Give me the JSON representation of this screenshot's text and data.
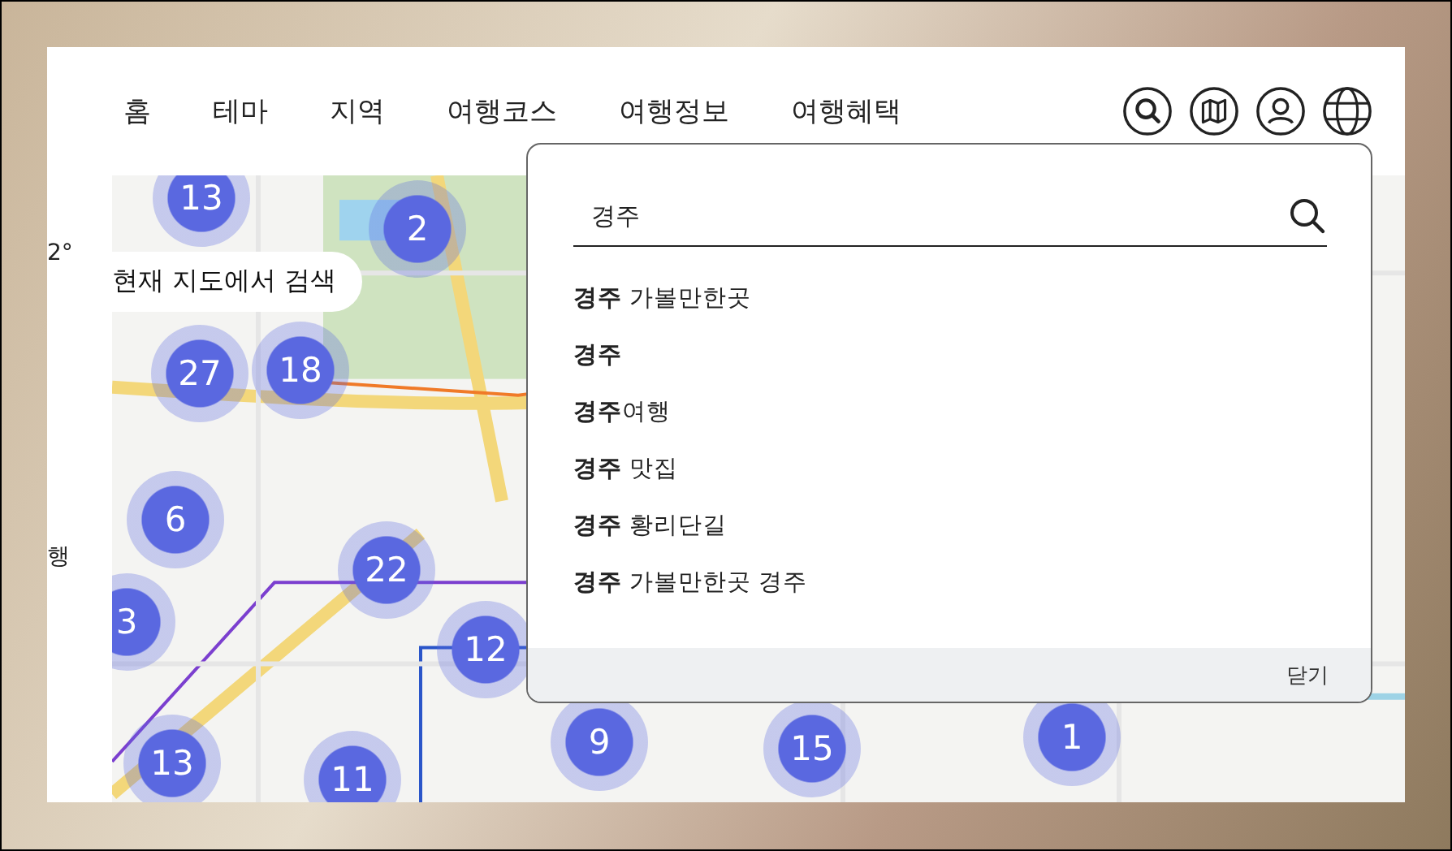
{
  "nav": {
    "items": [
      {
        "label": "홈"
      },
      {
        "label": "테마"
      },
      {
        "label": "지역"
      },
      {
        "label": "여행코스"
      },
      {
        "label": "여행정보"
      },
      {
        "label": "여행혜택"
      }
    ]
  },
  "left_panel": {
    "texts": [
      "2°",
      "행"
    ]
  },
  "map": {
    "search_here_button": "현재 지도에서 검색",
    "clusters": [
      {
        "count": "13"
      },
      {
        "count": "2"
      },
      {
        "count": "27"
      },
      {
        "count": "18"
      },
      {
        "count": "6"
      },
      {
        "count": "22"
      },
      {
        "count": "3"
      },
      {
        "count": "12"
      },
      {
        "count": "9"
      },
      {
        "count": "15"
      },
      {
        "count": "1"
      },
      {
        "count": "13"
      },
      {
        "count": "11"
      }
    ]
  },
  "search_popup": {
    "query": "경주",
    "suggestions": [
      "**경주** 가볼만한곳",
      "**경주**",
      "**경주**여행",
      "**경주** 맛집",
      "**경주** 황리단길",
      "**경주** 가볼만한곳 경주"
    ],
    "close": "닫기"
  }
}
